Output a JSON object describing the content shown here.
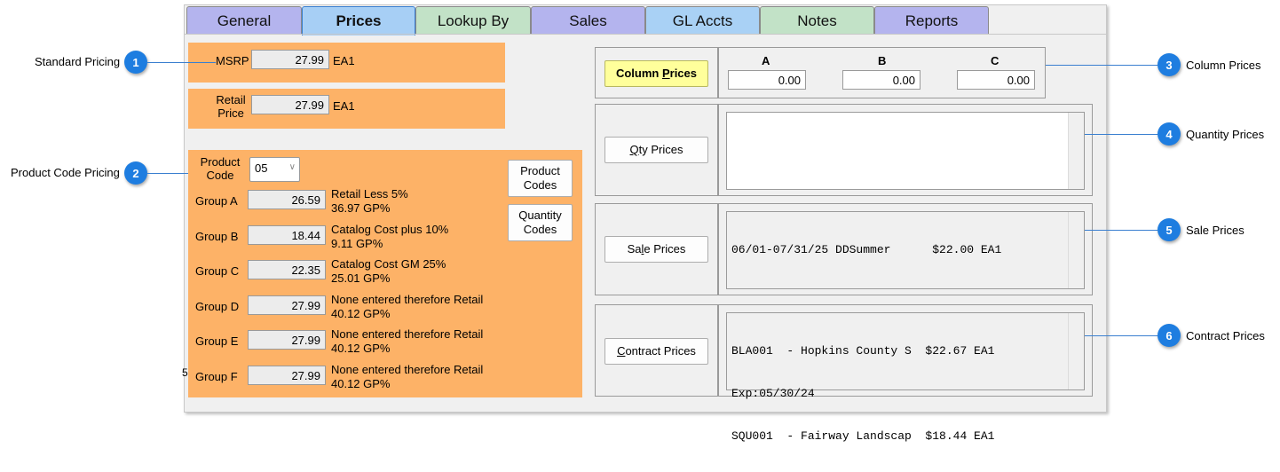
{
  "tabs": [
    {
      "label": "General"
    },
    {
      "label": "Prices"
    },
    {
      "label": "Lookup By"
    },
    {
      "label": "Sales"
    },
    {
      "label": "GL Accts"
    },
    {
      "label": "Notes"
    },
    {
      "label": "Reports"
    }
  ],
  "standard_pricing": {
    "msrp_label": "MSRP",
    "msrp_value": "27.99",
    "msrp_unit": "EA1",
    "retail_label_1": "Retail",
    "retail_label_2": "Price",
    "retail_value": "27.99",
    "retail_unit": "EA1"
  },
  "product_code_pricing": {
    "product_code_label_1": "Product",
    "product_code_label_2": "Code",
    "product_code_value": "05",
    "groups": [
      {
        "label": "Group A",
        "value": "26.59",
        "desc1": "Retail Less 5%",
        "desc2": "36.97 GP%"
      },
      {
        "label": "Group B",
        "value": "18.44",
        "desc1": "Catalog Cost plus 10%",
        "desc2": "9.11 GP%"
      },
      {
        "label": "Group C",
        "value": "22.35",
        "desc1": "Catalog Cost GM 25%",
        "desc2": "25.01 GP%"
      },
      {
        "label": "Group D",
        "value": "27.99",
        "desc1": "None entered therefore Retail",
        "desc2": "40.12 GP%"
      },
      {
        "label": "Group E",
        "value": "27.99",
        "desc1": "None entered therefore Retail",
        "desc2": "40.12 GP%"
      },
      {
        "label": "Group F",
        "value": "27.99",
        "desc1": "None entered therefore Retail",
        "desc2": "40.12 GP%"
      }
    ],
    "product_codes_btn_1": "Product",
    "product_codes_btn_2": "Codes",
    "quantity_codes_btn_1": "Quantity",
    "quantity_codes_btn_2": "Codes"
  },
  "column_prices": {
    "button": {
      "pre": "Column ",
      "accel": "P",
      "post": "rices"
    },
    "columns": [
      {
        "header": "A",
        "value": "0.00"
      },
      {
        "header": "B",
        "value": "0.00"
      },
      {
        "header": "C",
        "value": "0.00"
      }
    ]
  },
  "qty_prices": {
    "button": {
      "pre": "",
      "accel": "Q",
      "post": "ty Prices"
    }
  },
  "sale_prices": {
    "button": {
      "pre": "Sa",
      "accel": "l",
      "post": "e Prices"
    },
    "lines": [
      "06/01-07/31/25 DDSummer      $22.00 EA1"
    ]
  },
  "contract_prices": {
    "button": {
      "pre": "",
      "accel": "C",
      "post": "ontract Prices"
    },
    "lines": [
      "BLA001  - Hopkins County S  $22.67 EA1",
      "Exp:05/30/24",
      "SQU001  - Fairway Landscap  $18.44 EA1"
    ]
  },
  "callouts": [
    {
      "number": "1",
      "label": "Standard Pricing"
    },
    {
      "number": "2",
      "label": "Product Code Pricing"
    },
    {
      "number": "3",
      "label": "Column Prices"
    },
    {
      "number": "4",
      "label": "Quantity Prices"
    },
    {
      "number": "5",
      "label": "Sale Prices"
    },
    {
      "number": "6",
      "label": "Contract Prices"
    }
  ],
  "stray_mark": "5",
  "colors": {
    "orange": "#fdb267",
    "tab_purple": "#b4b4ee",
    "tab_green": "#c2e2c7",
    "tab_blue": "#a9d1f5",
    "callout_blue": "#1e7de0",
    "button_yellow": "#ffff9b"
  }
}
